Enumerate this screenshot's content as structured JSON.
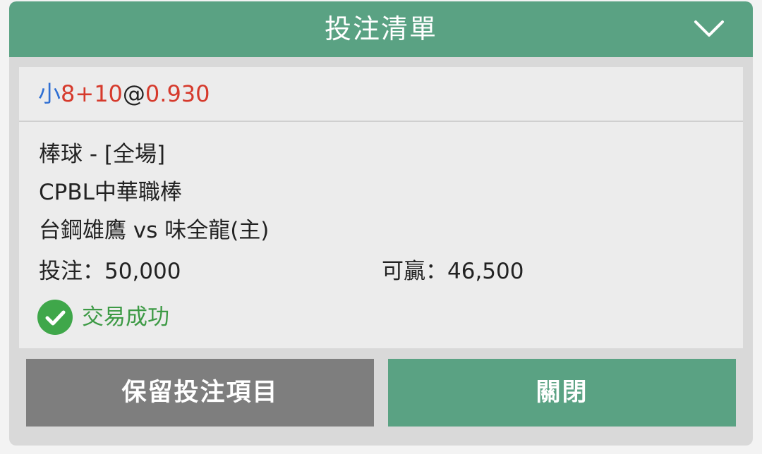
{
  "header": {
    "title": "投注清單",
    "collapse_icon": "chevron-down-icon"
  },
  "selection": {
    "side": "小",
    "line": "8+10",
    "at": "@",
    "odds": "0.930"
  },
  "details": {
    "sport_market": "棒球 - [全場]",
    "league": "CPBL中華職棒",
    "match": "台鋼雄鷹 vs 味全龍(主)",
    "stake_label": "投注：50,000",
    "win_label": "可贏：46,500"
  },
  "status": {
    "icon": "check-circle-icon",
    "text": "交易成功"
  },
  "buttons": {
    "keep_label": "保留投注項目",
    "close_label": "關閉"
  },
  "colors": {
    "accent": "#5aa283",
    "side_blue": "#2f6fd3",
    "odds_red": "#d63a2c",
    "success_green": "#3fa74a",
    "keep_button_gray": "#7e7e7e"
  }
}
